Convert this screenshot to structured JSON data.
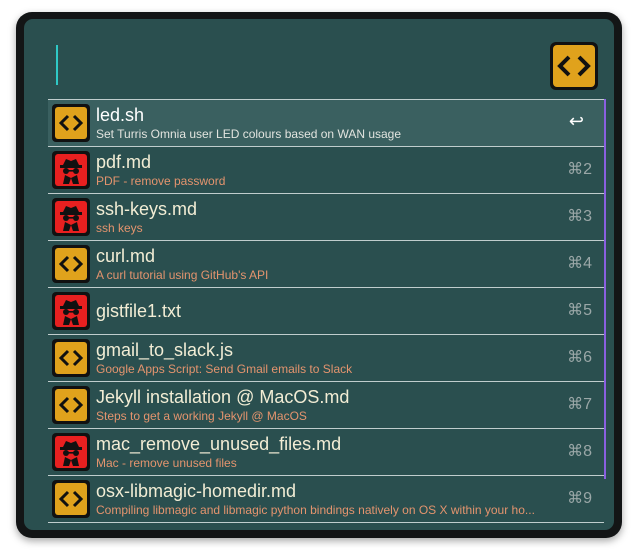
{
  "search": {
    "value": "",
    "placeholder": ""
  },
  "colors": {
    "panel": "#2a4f4f",
    "selected_row": "#3a6060",
    "title": "#f2edd5",
    "subtitle": "#e4946e",
    "shortcut": "#9aa7a7",
    "caret": "#2fc9c6",
    "scrollbar": "#8a5fe0",
    "code_icon_bg": "#e0a21c",
    "spy_icon_bg": "#e82020"
  },
  "results": [
    {
      "icon": "code-icon",
      "title": "led.sh",
      "subtitle": "Set Turris Omnia user LED colours based on WAN usage",
      "shortcut": "↩",
      "selected": true
    },
    {
      "icon": "spy-icon",
      "title": "pdf.md",
      "subtitle": "PDF - remove password",
      "shortcut": "⌘2"
    },
    {
      "icon": "spy-icon",
      "title": "ssh-keys.md",
      "subtitle": "ssh keys",
      "shortcut": "⌘3"
    },
    {
      "icon": "code-icon",
      "title": "curl.md",
      "subtitle": "A curl tutorial using GitHub's API",
      "shortcut": "⌘4"
    },
    {
      "icon": "spy-icon",
      "title": "gistfile1.txt",
      "subtitle": "",
      "shortcut": "⌘5"
    },
    {
      "icon": "code-icon",
      "title": "gmail_to_slack.js",
      "subtitle": "Google Apps Script: Send Gmail emails to Slack",
      "shortcut": "⌘6"
    },
    {
      "icon": "code-icon",
      "title": "Jekyll installation @ MacOS.md",
      "subtitle": "Steps to get a working Jekyll @ MacOS",
      "shortcut": "⌘7"
    },
    {
      "icon": "spy-icon",
      "title": "mac_remove_unused_files.md",
      "subtitle": "Mac - remove unused files",
      "shortcut": "⌘8"
    },
    {
      "icon": "code-icon",
      "title": "osx-libmagic-homedir.md",
      "subtitle": "Compiling libmagic and libmagic python bindings natively on OS X within your ho...",
      "shortcut": "⌘9"
    }
  ]
}
